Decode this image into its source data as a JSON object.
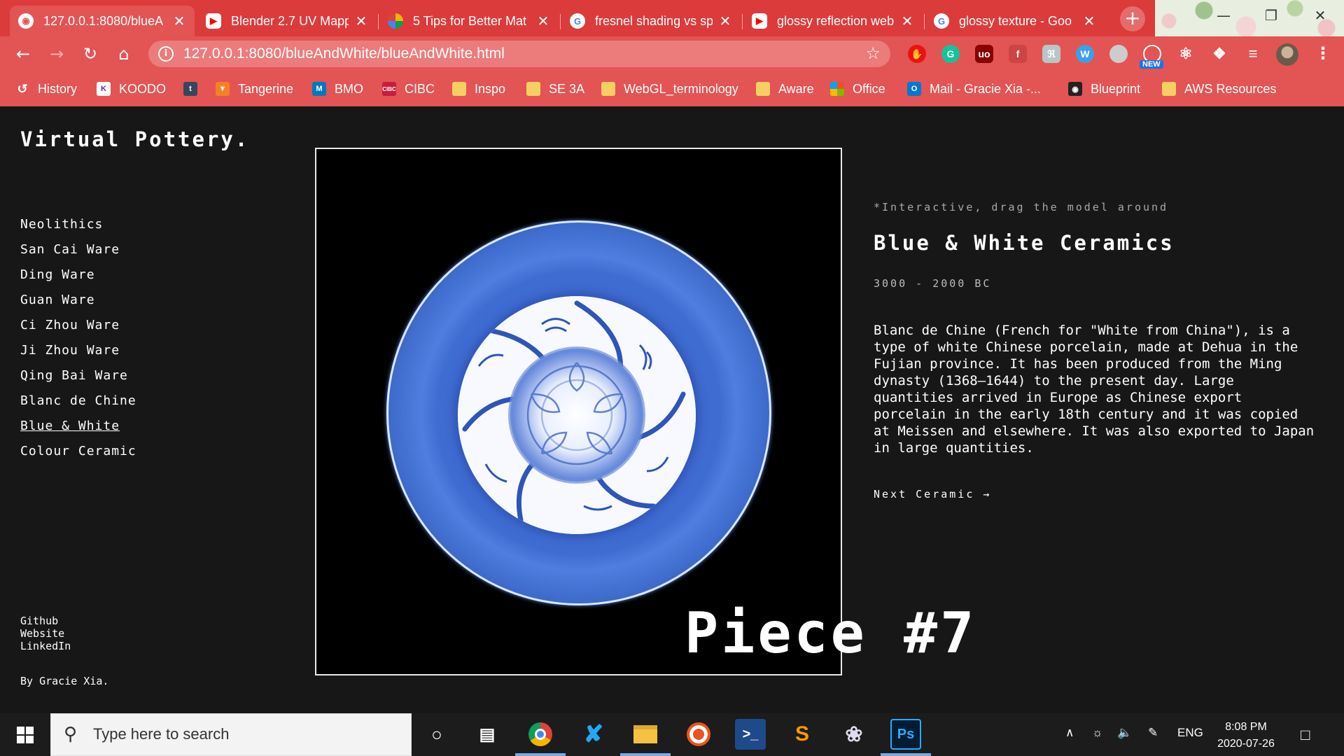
{
  "browser": {
    "tabs": [
      {
        "title": "127.0.0.1:8080/blueA",
        "icon": "globe-icon",
        "active": true
      },
      {
        "title": "Blender 2.7 UV Mapp",
        "icon": "youtube-icon",
        "active": false
      },
      {
        "title": "5 Tips for Better Mat",
        "icon": "pinwheel-icon",
        "active": false
      },
      {
        "title": "fresnel shading vs sp",
        "icon": "google-icon",
        "active": false
      },
      {
        "title": "glossy reflection web",
        "icon": "youtube-icon",
        "active": false
      },
      {
        "title": "glossy texture - Goo",
        "icon": "google-icon",
        "active": false
      }
    ],
    "url": "127.0.0.1:8080/blueAndWhite/blueAndWhite.html",
    "extensions_badge": "NEW",
    "bookmarks": [
      {
        "label": "History",
        "icon": "history-icon"
      },
      {
        "label": "KOODO",
        "icon": "koodo-icon"
      },
      {
        "label": "",
        "icon": "tumblr-icon"
      },
      {
        "label": "Tangerine",
        "icon": "tangerine-icon"
      },
      {
        "label": "BMO",
        "icon": "bmo-icon"
      },
      {
        "label": "CIBC",
        "icon": "cibc-icon"
      },
      {
        "label": "Inspo",
        "icon": "folder-icon"
      },
      {
        "label": "SE 3A",
        "icon": "folder-icon"
      },
      {
        "label": "WebGL_terminology",
        "icon": "folder-icon"
      },
      {
        "label": "Aware",
        "icon": "folder-icon"
      },
      {
        "label": "Office",
        "icon": "office-icon"
      },
      {
        "label": "Mail - Gracie Xia -...",
        "icon": "outlook-icon"
      },
      {
        "label": "Blueprint",
        "icon": "blueprint-icon"
      },
      {
        "label": "AWS Resources",
        "icon": "folder-icon"
      }
    ]
  },
  "site": {
    "title": "Virtual Pottery.",
    "nav": [
      "Neolithics",
      "San Cai Ware",
      "Ding Ware",
      "Guan Ware",
      "Ci Zhou Ware",
      "Ji Zhou Ware",
      "Qing Bai Ware",
      "Blanc de Chine",
      "Blue & White",
      "Colour Ceramic"
    ],
    "current_nav": "Blue & White",
    "links": [
      "Github",
      "Website",
      "LinkedIn"
    ],
    "author": "By Gracie Xia."
  },
  "piece": {
    "hint": "*Interactive, drag the model around",
    "title": "Blue & White Ceramics",
    "era": "3000 - 2000 BC",
    "description": "Blanc de Chine (French for \"White from China\"), is a type of white Chinese porcelain, made at Dehua in the Fujian province. It has been produced from the Ming dynasty (1368–1644) to the present day. Large quantities arrived in Europe as Chinese export porcelain in the early 18th century and it was copied at Meissen and elsewhere. It was also exported to Japan in large quantities.",
    "next_label": "Next Ceramic →",
    "number_label": "Piece #7"
  },
  "colors": {
    "page_bg": "#171717",
    "chrome_red": "#e35454",
    "bowl_blue": "#3a66c6"
  },
  "taskbar": {
    "search_placeholder": "Type here to search",
    "language": "ENG",
    "time": "8:08 PM",
    "date": "2020-07-26",
    "pinned": [
      "cortana-icon",
      "task-view-icon",
      "chrome-icon",
      "vscode-icon",
      "file-explorer-icon",
      "ubuntu-icon",
      "powershell-icon",
      "sublime-icon",
      "paint-icon",
      "photoshop-icon"
    ]
  }
}
